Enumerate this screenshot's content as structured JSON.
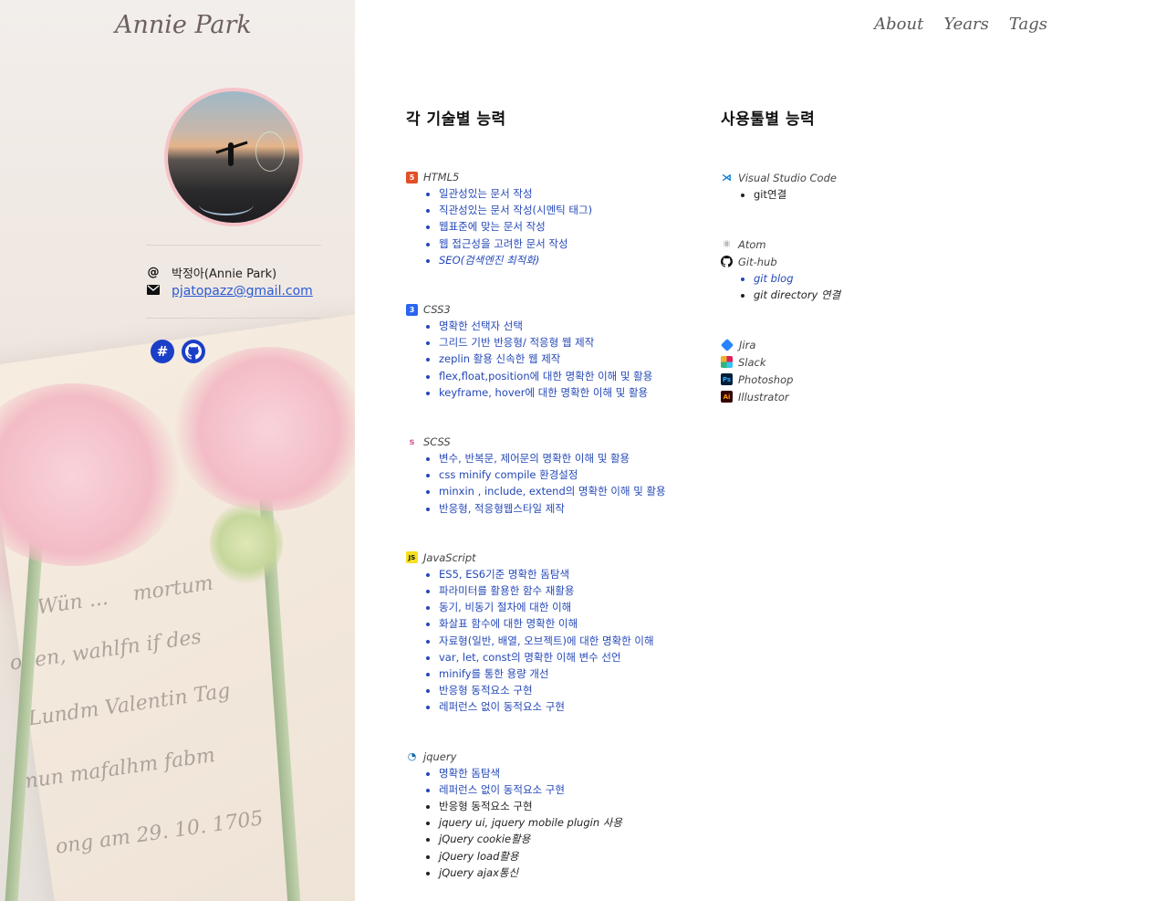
{
  "brand": {
    "title": "Annie Park"
  },
  "nav": {
    "items": [
      "About",
      "Years",
      "Tags"
    ]
  },
  "profile": {
    "name": "박정아(Annie Park)",
    "email": "pjatopazz@gmail.com"
  },
  "social": {
    "icons": [
      "slack-icon",
      "github-icon"
    ]
  },
  "skills": {
    "heading": "각 기술별 능력",
    "groups": [
      {
        "name": "HTML5",
        "icon": "html5-icon",
        "items": [
          "일관성있는 문서 작성",
          "직관성있는 문서 작성(시멘틱 태그)",
          "웹표준에 맞는 문서 작성",
          "웹 접근성을 고려한 문서 작성",
          "SEO(검색엔진 최적화)"
        ]
      },
      {
        "name": "CSS3",
        "icon": "css3-icon",
        "items": [
          "명확한 선택자 선택",
          "그리드 기반 반응형/ 적응형 웹 제작",
          "zeplin 활용 신속한 웹 제작",
          "flex,float,position에 대한 명확한 이해 및 활용",
          "keyframe, hover에 대한 명확한 이해 및 활용"
        ]
      },
      {
        "name": "SCSS",
        "icon": "sass-icon",
        "items": [
          "변수, 반복문, 제어문의 명확한 이해 및 활용",
          "css minify compile 환경설정",
          "minxin , include, extend의 명확한 이해 및 활용",
          "반응형, 적응형웹스타일 제작"
        ]
      },
      {
        "name": "JavaScript",
        "icon": "javascript-icon",
        "items": [
          "ES5, ES6기준 명확한 돔탐색",
          "파라미터를 활용한 함수 재활용",
          "동기, 비동기 절차에 대한 이해",
          "화살표 함수에 대한 명확한 이해",
          "자료형(일반, 배열, 오브젝트)에 대한 명확한 이해",
          "var, let, const의 명확한 이해 변수 선언",
          "minify를 통한 용량 개선",
          "반응형 동적요소 구현",
          "레퍼런스 없이 동적요소 구현"
        ]
      },
      {
        "name": "jquery",
        "icon": "jquery-icon",
        "items": [
          "명확한 돔탐색",
          "레퍼런스 없이 동적요소 구현",
          "반응형 동적요소 구현",
          "jquery ui, jquery mobile plugin 사용",
          "jQuery cookie활용",
          "jQuery load활용",
          "jQuery ajax통신"
        ]
      }
    ]
  },
  "tools": {
    "heading": "사용툴별 능력",
    "vscode": {
      "name": "Visual Studio Code",
      "items": [
        "git연결"
      ]
    },
    "atom": {
      "name": "Atom"
    },
    "github": {
      "name": "Git-hub",
      "items": [
        "git blog",
        "git directory 연결"
      ]
    },
    "others": [
      "Jira",
      "Slack",
      "Photoshop",
      "Illustrator"
    ]
  },
  "colors": {
    "link": "#2448b8",
    "accent_pink": "#f5c4c8",
    "slack_blue": "#1b3fc7"
  }
}
